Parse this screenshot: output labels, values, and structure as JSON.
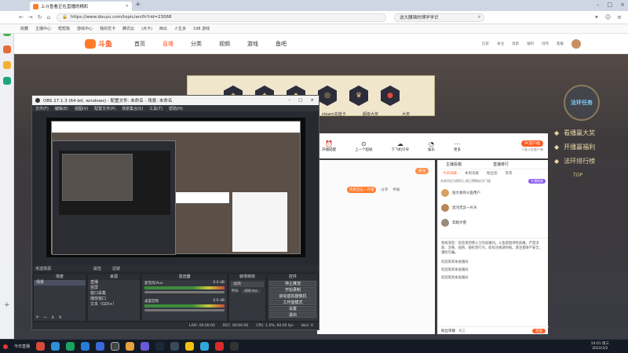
{
  "browser": {
    "tab_title": "上斗鱼看正在直播的精彩",
    "url": "https://www.douyu.com/topic/arcfh?rid=23068",
    "search_text": "送大腰钢的博学学识",
    "bookmarks": [
      "收藏",
      "主播中心",
      "帮帮我",
      "游戏中心",
      "我的优卡",
      "腾讯云",
      "(点卡)",
      "西瓜",
      "人生多",
      "198 游戏"
    ]
  },
  "site": {
    "logo": "斗鱼",
    "nav": [
      "首页",
      "直播",
      "分类",
      "视频",
      "游戏",
      "鱼吧"
    ],
    "header_icons": [
      "历史",
      "关注",
      "消息",
      "福利",
      "创作",
      "客服"
    ],
    "banner_label_1": "steam充值卡",
    "banner_label_2": "超级大奖",
    "banner_label_3": "大奖",
    "room_tools": [
      "开播提醒",
      "上一个超级",
      "下飞机引导",
      "娱乐",
      "更多"
    ],
    "pc_client": "PC客户端",
    "pc_client_sub": "下载斗鱼客户端",
    "gift_btn": "找到宝石 / 开箱",
    "share": "分享",
    "report": "举报",
    "follow": "关注",
    "side_menu": [
      "看播赢大奖",
      "开播赢福利",
      "法环排行榜"
    ],
    "top": "TOP",
    "event_badge": "法环任务"
  },
  "chat": {
    "tabs": [
      "主播投稿",
      "直播排行"
    ],
    "subtabs": [
      "今日贡献",
      "本周贡献",
      "粉丝团",
      "贵宾"
    ],
    "notice": "本房间在法期间上周已撰稿这次门槛",
    "notice_btn": "开通贵族",
    "users": [
      {
        "name": "逍大会的斗鱼用户"
      },
      {
        "name": "混沌无云一片天"
      },
      {
        "name": "奔跑大使"
      }
    ],
    "system_msg": "系统消息：欢迎来到博斗士的直播间。斗鱼提倡绿色直播，严禁涉政、涉黄、低俗、侵权等行为，如有违规请举报。请注意财产安全，谨防诈骗。",
    "messages": [
      "欢迎来到本直播间",
      "欢迎来到本直播间",
      "欢迎来到本直播间"
    ],
    "bottom_left": "粉丝荣耀 ",
    "bottom_right": "发言",
    "send": "发送"
  },
  "obs": {
    "title": "OBS 27.1.3 (64-bit, windows) - 配置文件: 未命名 - 场景: 未命名",
    "menu": [
      "文件(F)",
      "编辑(E)",
      "视图(V)",
      "配置文件(P)",
      "场景集合(S)",
      "工具(T)",
      "帮助(H)"
    ],
    "source_bar": [
      "未选择源",
      "属性",
      "滤镜"
    ],
    "dock_scenes": "场景",
    "dock_sources": "来源",
    "dock_mixer": "混音器",
    "dock_transitions": "转场特效",
    "dock_controls": "控件",
    "scenes": [
      "场景"
    ],
    "sources": [
      "直播",
      "竖屏",
      "窗口采集",
      "播放窗口",
      "文本（GDI+）"
    ],
    "mixer": [
      {
        "name": "麦克风/Aux",
        "db": "0.0 dB"
      },
      {
        "name": "桌面音频",
        "db": "0.0 dB"
      }
    ],
    "transition": "淡出",
    "duration_label": "时长",
    "duration": "300 ms",
    "controls": [
      "停止推流",
      "开始录制",
      "启动虚拟摄像机",
      "工作室模式",
      "设置",
      "退出"
    ],
    "status": {
      "live": "LIVE: 00:00:00",
      "rec": "REC: 00:00:00",
      "cpu": "CPU: 1.0%, 60.00 fps",
      "kb": "kb/s: 0"
    }
  },
  "taskbar": {
    "start": "今日直播",
    "time": "10:01 周三",
    "date": "2022/3/2"
  },
  "colors": {
    "accent": "#ff5d23",
    "gold": "#e6c86e",
    "obs_bg": "#282a31"
  }
}
